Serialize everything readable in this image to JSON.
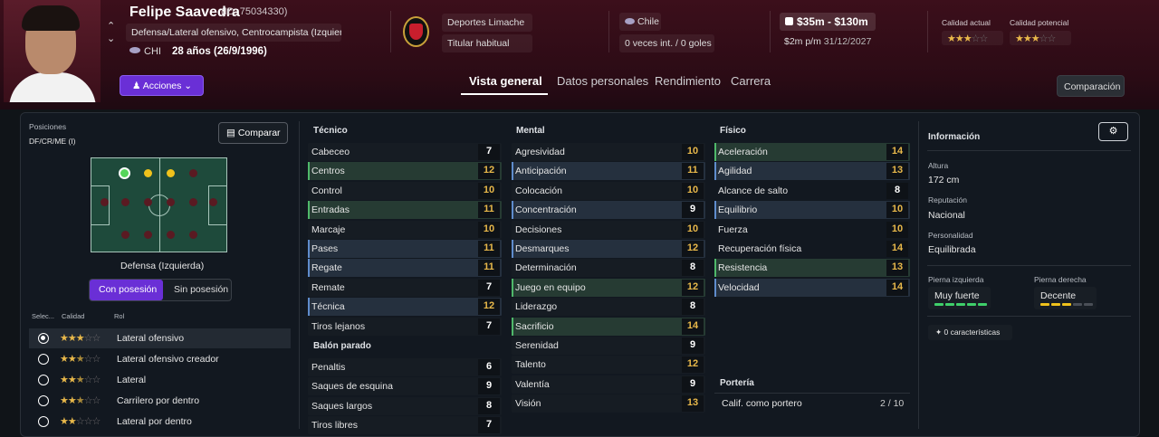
{
  "header": {
    "name": "Felipe Saavedra",
    "id": "(ID: 75034330)",
    "positions": "Defensa/Lateral ofensivo, Centrocampista (Izquierda)",
    "nation_code": "CHI",
    "age": "28 años (26/9/1996)",
    "actions_button": "Acciones",
    "club": "Deportes Limache",
    "squad_status": "Titular habitual",
    "country": "Chile",
    "caps": "0 veces int. / 0 goles",
    "value": "$35m - $130m",
    "wage": "$2m p/m",
    "contract_end": "31/12/2027",
    "current_ability_label": "Calidad actual",
    "potential_ability_label": "Calidad potencial",
    "current_ability_stars": 3,
    "potential_ability_stars": 3
  },
  "tabs": [
    "Vista general",
    "Datos personales",
    "Rendimiento",
    "Carrera"
  ],
  "compare_top_button": "Comparación",
  "left": {
    "positions_label": "Posiciones",
    "positions_value": "DF/CR/ME (I)",
    "compare_button": "Comparar",
    "position_name": "Defensa (Izquierda)",
    "toggle_on": "Con posesión",
    "toggle_off": "Sin posesión",
    "col_select": "Selec...",
    "col_quality": "Calidad",
    "col_role": "Rol",
    "roles": [
      {
        "name": "Lateral ofensivo",
        "stars": 3
      },
      {
        "name": "Lateral ofensivo creador",
        "stars": 2.5
      },
      {
        "name": "Lateral",
        "stars": 2.5
      },
      {
        "name": "Carrilero por dentro",
        "stars": 2.5
      },
      {
        "name": "Lateral por dentro",
        "stars": 2
      }
    ]
  },
  "tecnico": {
    "title": "Técnico",
    "attrs": [
      [
        "Cabeceo",
        "7"
      ],
      [
        "Centros",
        "12"
      ],
      [
        "Control",
        "10"
      ],
      [
        "Entradas",
        "11"
      ],
      [
        "Marcaje",
        "10"
      ],
      [
        "Pases",
        "11"
      ],
      [
        "Regate",
        "11"
      ],
      [
        "Remate",
        "7"
      ],
      [
        "Técnica",
        "12"
      ],
      [
        "Tiros lejanos",
        "7"
      ]
    ]
  },
  "balon_parado": {
    "title": "Balón parado",
    "attrs": [
      [
        "Penaltis",
        "6"
      ],
      [
        "Saques de esquina",
        "9"
      ],
      [
        "Saques largos",
        "8"
      ],
      [
        "Tiros libres",
        "7"
      ]
    ]
  },
  "mental": {
    "title": "Mental",
    "attrs": [
      [
        "Agresividad",
        "10"
      ],
      [
        "Anticipación",
        "11"
      ],
      [
        "Colocación",
        "10"
      ],
      [
        "Concentración",
        "9"
      ],
      [
        "Decisiones",
        "10"
      ],
      [
        "Desmarques",
        "12"
      ],
      [
        "Determinación",
        "8"
      ],
      [
        "Juego en equipo",
        "12"
      ],
      [
        "Liderazgo",
        "8"
      ],
      [
        "Sacrificio",
        "14"
      ],
      [
        "Serenidad",
        "9"
      ],
      [
        "Talento",
        "12"
      ],
      [
        "Valentía",
        "9"
      ],
      [
        "Visión",
        "13"
      ]
    ]
  },
  "fisico": {
    "title": "Físico",
    "attrs": [
      [
        "Aceleración",
        "14"
      ],
      [
        "Agilidad",
        "13"
      ],
      [
        "Alcance de salto",
        "8"
      ],
      [
        "Equilibrio",
        "10"
      ],
      [
        "Fuerza",
        "10"
      ],
      [
        "Recuperación física",
        "14"
      ],
      [
        "Resistencia",
        "13"
      ],
      [
        "Velocidad",
        "14"
      ]
    ]
  },
  "porteria": {
    "title": "Portería",
    "label": "Calif. como portero",
    "value": "2 / 10"
  },
  "info": {
    "title": "Información",
    "height_label": "Altura",
    "height": "172 cm",
    "reputation_label": "Reputación",
    "reputation": "Nacional",
    "personality_label": "Personalidad",
    "personality": "Equilibrada",
    "left_foot_label": "Pierna izquierda",
    "left_foot": "Muy fuerte",
    "left_foot_level": 5,
    "right_foot_label": "Pierna derecha",
    "right_foot": "Decente",
    "right_foot_level": 3,
    "characteristics": "0 características"
  }
}
